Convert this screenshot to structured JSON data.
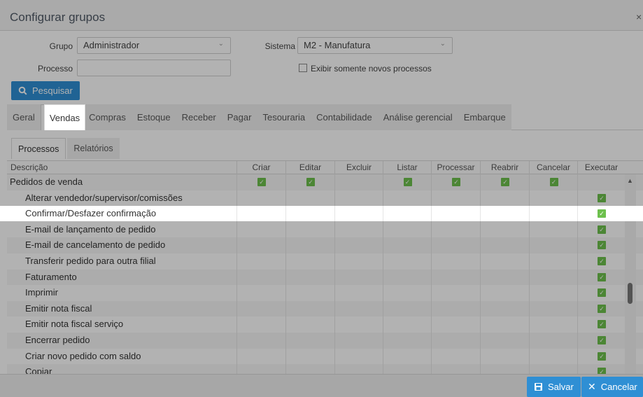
{
  "title": "Configurar grupos",
  "close_label": "×",
  "form": {
    "grupo_label": "Grupo",
    "grupo_value": "Administrador",
    "sistema_label": "Sistema",
    "sistema_value": "M2 - Manufatura",
    "processo_label": "Processo",
    "processo_value": "",
    "checkbox_label": "Exibir somente novos processos",
    "search_label": "Pesquisar"
  },
  "tabs": [
    "Geral",
    "Vendas",
    "Compras",
    "Estoque",
    "Receber",
    "Pagar",
    "Tesouraria",
    "Contabilidade",
    "Análise gerencial",
    "Embarque"
  ],
  "active_tab": "Vendas",
  "subtabs": [
    "Processos",
    "Relatórios"
  ],
  "active_subtab": "Processos",
  "columns": [
    "Descrição",
    "Criar",
    "Editar",
    "Excluir",
    "Listar",
    "Processar",
    "Reabrir",
    "Cancelar",
    "Executar"
  ],
  "rows": [
    {
      "label": "Pedidos de venda",
      "indent": false,
      "checks": [
        true,
        true,
        false,
        true,
        true,
        true,
        true,
        false
      ]
    },
    {
      "label": "Alterar vendedor/supervisor/comissões",
      "indent": true,
      "checks": [
        false,
        false,
        false,
        false,
        false,
        false,
        false,
        true
      ]
    },
    {
      "label": "Confirmar/Desfazer confirmação",
      "indent": true,
      "checks": [
        false,
        false,
        false,
        false,
        false,
        false,
        false,
        true
      ],
      "selected": true
    },
    {
      "label": "E-mail de lançamento de pedido",
      "indent": true,
      "checks": [
        false,
        false,
        false,
        false,
        false,
        false,
        false,
        true
      ]
    },
    {
      "label": "E-mail de cancelamento de pedido",
      "indent": true,
      "checks": [
        false,
        false,
        false,
        false,
        false,
        false,
        false,
        true
      ]
    },
    {
      "label": "Transferir pedido para outra filial",
      "indent": true,
      "checks": [
        false,
        false,
        false,
        false,
        false,
        false,
        false,
        true
      ]
    },
    {
      "label": "Faturamento",
      "indent": true,
      "checks": [
        false,
        false,
        false,
        false,
        false,
        false,
        false,
        true
      ]
    },
    {
      "label": "Imprimir",
      "indent": true,
      "checks": [
        false,
        false,
        false,
        false,
        false,
        false,
        false,
        true
      ]
    },
    {
      "label": "Emitir nota fiscal",
      "indent": true,
      "checks": [
        false,
        false,
        false,
        false,
        false,
        false,
        false,
        true
      ]
    },
    {
      "label": "Emitir nota fiscal serviço",
      "indent": true,
      "checks": [
        false,
        false,
        false,
        false,
        false,
        false,
        false,
        true
      ]
    },
    {
      "label": "Encerrar pedido",
      "indent": true,
      "checks": [
        false,
        false,
        false,
        false,
        false,
        false,
        false,
        true
      ]
    },
    {
      "label": "Criar novo pedido com saldo",
      "indent": true,
      "checks": [
        false,
        false,
        false,
        false,
        false,
        false,
        false,
        true
      ]
    },
    {
      "label": "Copiar",
      "indent": true,
      "checks": [
        false,
        false,
        false,
        false,
        false,
        false,
        false,
        true
      ]
    }
  ],
  "footer": {
    "save_label": "Salvar",
    "cancel_label": "Cancelar"
  },
  "colors": {
    "primary": "#2f8fd4",
    "check": "#6dc04d",
    "overlay": "rgba(0,0,0,0.3)"
  }
}
